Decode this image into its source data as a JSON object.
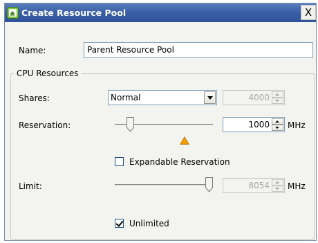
{
  "dialog": {
    "title": "Create Resource Pool",
    "close_label": "X"
  },
  "name_field": {
    "label": "Name:",
    "value": "Parent Resource Pool"
  },
  "cpu": {
    "group_label": "CPU Resources",
    "shares": {
      "label": "Shares:",
      "selected": "Normal",
      "value": "4000"
    },
    "reservation": {
      "label": "Reservation:",
      "value": "1000",
      "unit": "MHz",
      "slider_fraction": 0.13
    },
    "expandable": {
      "label": "Expandable Reservation",
      "checked": false
    },
    "limit": {
      "label": "Limit:",
      "value": "8054",
      "unit": "MHz",
      "slider_fraction": 1.0
    },
    "unlimited": {
      "label": "Unlimited",
      "checked": true
    }
  },
  "colors": {
    "titlebar": "#3b60a8",
    "warning": "#f0a000"
  },
  "icons": {
    "app": "resource-pool-icon",
    "warning": "warning-triangle-icon"
  }
}
